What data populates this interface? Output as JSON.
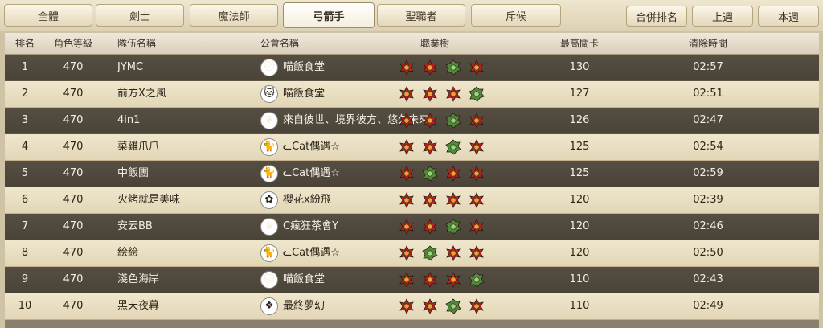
{
  "tabs": [
    "全體",
    "劍士",
    "魔法師",
    "弓箭手",
    "聖職者",
    "斥候"
  ],
  "active_tab": 3,
  "buttons": {
    "merge": "合併排名",
    "last_week": "上週",
    "this_week": "本週"
  },
  "headers": {
    "rank": "排名",
    "level": "角色等級",
    "team": "隊伍名稱",
    "guild": "公會名稱",
    "jobs": "職業樹",
    "stage": "最高關卡",
    "time": "清除時間"
  },
  "colors": {
    "red_emblem": "#b8231c",
    "green_emblem": "#4e8c3a",
    "dark_row": "#4f473b",
    "light_row": "#e9dfc2"
  },
  "rows": [
    {
      "rank": "1",
      "level": "470",
      "team": "JYMC",
      "guild": "喵飯食堂",
      "guild_icon": "cat-avatar-icon",
      "jobs": [
        "red",
        "red",
        "green",
        "red"
      ],
      "stage": "130",
      "time": "02:57"
    },
    {
      "rank": "2",
      "level": "470",
      "team": "前方X之風",
      "guild": "喵飯食堂",
      "guild_icon": "cat-avatar-icon",
      "jobs": [
        "red",
        "red",
        "red",
        "green"
      ],
      "stage": "127",
      "time": "02:51"
    },
    {
      "rank": "3",
      "level": "470",
      "team": "4in1",
      "guild": "來自彼世、境界彼方、悠久未來",
      "guild_icon": "phoenix-icon",
      "jobs": [
        "red",
        "red",
        "green",
        "red"
      ],
      "stage": "126",
      "time": "02:47"
    },
    {
      "rank": "4",
      "level": "470",
      "team": "菜雞爪爪",
      "guild": "ᓚCat偶遇☆",
      "guild_icon": "cat-face-icon",
      "jobs": [
        "red",
        "red",
        "green",
        "red"
      ],
      "stage": "125",
      "time": "02:54"
    },
    {
      "rank": "5",
      "level": "470",
      "team": "中飯團",
      "guild": "ᓚCat偶遇☆",
      "guild_icon": "cat-face-icon",
      "jobs": [
        "red",
        "green",
        "red",
        "red"
      ],
      "stage": "125",
      "time": "02:59"
    },
    {
      "rank": "6",
      "level": "470",
      "team": "火烤就是美味",
      "guild": "櫻花x紛飛",
      "guild_icon": "sakura-icon",
      "jobs": [
        "red",
        "red",
        "red",
        "red"
      ],
      "stage": "120",
      "time": "02:39"
    },
    {
      "rank": "7",
      "level": "470",
      "team": "安云BB",
      "guild": "C瘋狂茶會Y",
      "guild_icon": "tea-hat-icon",
      "jobs": [
        "red",
        "red",
        "green",
        "red"
      ],
      "stage": "120",
      "time": "02:46"
    },
    {
      "rank": "8",
      "level": "470",
      "team": "絵絵",
      "guild": "ᓚCat偶遇☆",
      "guild_icon": "cat-face-icon",
      "jobs": [
        "red",
        "green",
        "red",
        "red"
      ],
      "stage": "120",
      "time": "02:50"
    },
    {
      "rank": "9",
      "level": "470",
      "team": "淺色海岸",
      "guild": "喵飯食堂",
      "guild_icon": "cat-avatar-icon",
      "jobs": [
        "red",
        "red",
        "red",
        "green"
      ],
      "stage": "110",
      "time": "02:43"
    },
    {
      "rank": "10",
      "level": "470",
      "team": "黑天夜幕",
      "guild": "最終夢幻",
      "guild_icon": "scroll-icon",
      "jobs": [
        "red",
        "red",
        "green",
        "red"
      ],
      "stage": "110",
      "time": "02:49"
    }
  ]
}
